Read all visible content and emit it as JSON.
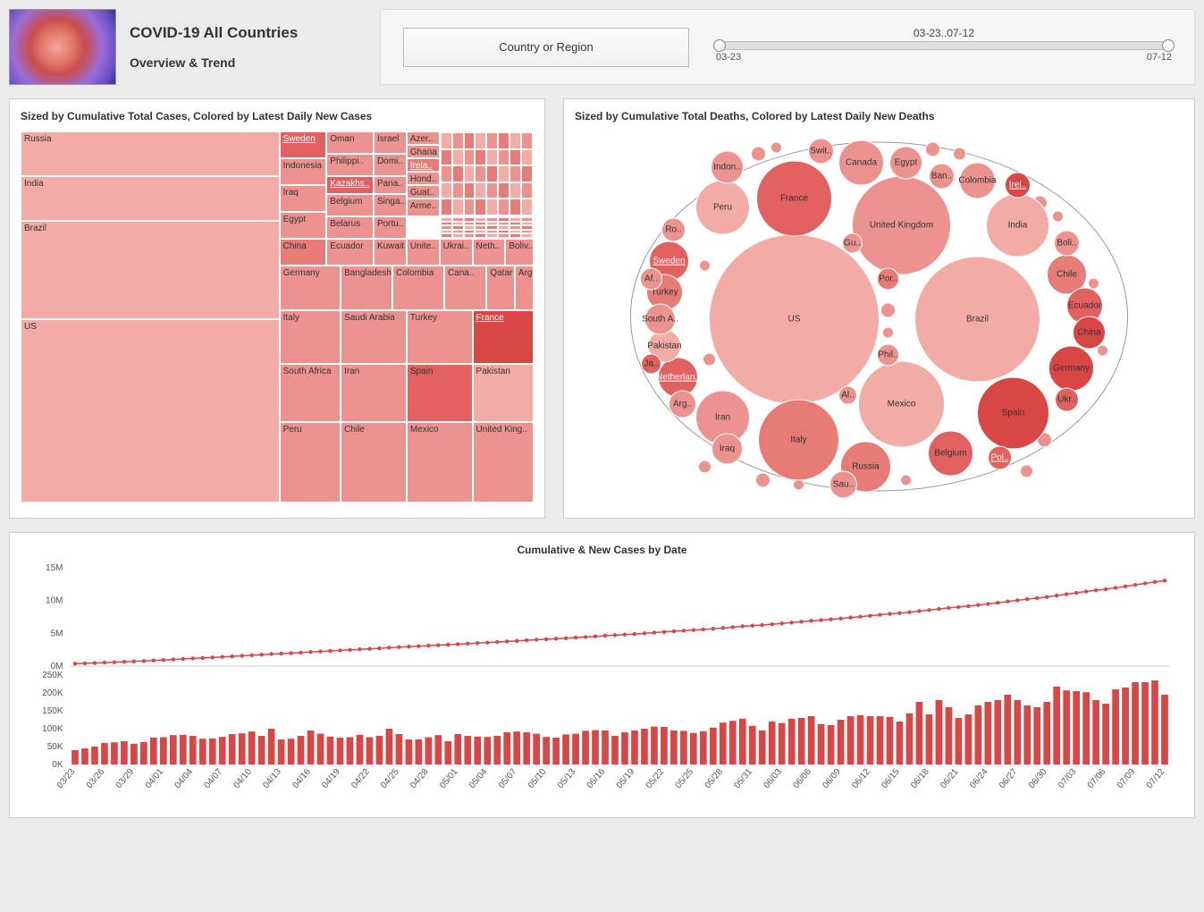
{
  "header": {
    "title": "COVID-19 All Countries",
    "subtitle": "Overview & Trend"
  },
  "filter": {
    "button_label": "Country or Region",
    "slider_label": "03-23..07-12",
    "slider_start": "03-23",
    "slider_end": "07-12"
  },
  "treemap_panel": {
    "title": "Sized by Cumulative Total Cases, Colored by Latest Daily New Cases"
  },
  "bubble_panel": {
    "title": "Sized by Cumulative Total Deaths, Colored by Latest Daily New Deaths"
  },
  "combo_panel": {
    "title": "Cumulative & New Cases by Date"
  },
  "chart_data": [
    {
      "type": "treemap",
      "title": "Sized by Cumulative Total Cases, Colored by Latest Daily New Cases",
      "items": [
        {
          "name": "US",
          "size": 3400000,
          "shade": 1
        },
        {
          "name": "Brazil",
          "size": 1850000,
          "shade": 1
        },
        {
          "name": "India",
          "size": 880000,
          "shade": 1
        },
        {
          "name": "Russia",
          "size": 730000,
          "shade": 1
        },
        {
          "name": "Peru",
          "size": 330000,
          "shade": 2
        },
        {
          "name": "Chile",
          "size": 315000,
          "shade": 2
        },
        {
          "name": "Mexico",
          "size": 300000,
          "shade": 2
        },
        {
          "name": "United Kingdom",
          "size": 290000,
          "shade": 2
        },
        {
          "name": "South Africa",
          "size": 275000,
          "shade": 2
        },
        {
          "name": "Iran",
          "size": 260000,
          "shade": 2
        },
        {
          "name": "Spain",
          "size": 255000,
          "shade": 4
        },
        {
          "name": "Pakistan",
          "size": 250000,
          "shade": 1
        },
        {
          "name": "Italy",
          "size": 243000,
          "shade": 2
        },
        {
          "name": "Saudi Arabia",
          "size": 235000,
          "shade": 2
        },
        {
          "name": "Turkey",
          "size": 215000,
          "shade": 2
        },
        {
          "name": "France",
          "size": 210000,
          "shade": 5,
          "highlight": true
        },
        {
          "name": "Germany",
          "size": 200000,
          "shade": 2
        },
        {
          "name": "Bangladesh",
          "size": 185000,
          "shade": 2
        },
        {
          "name": "Colombia",
          "size": 150000,
          "shade": 2
        },
        {
          "name": "Canada",
          "size": 108000,
          "shade": 2
        },
        {
          "name": "Qatar",
          "size": 104000,
          "shade": 2
        },
        {
          "name": "Argentina",
          "size": 100000,
          "shade": 2
        },
        {
          "name": "China",
          "size": 85000,
          "shade": 3
        },
        {
          "name": "Egypt",
          "size": 82000,
          "shade": 2
        },
        {
          "name": "Iraq",
          "size": 77000,
          "shade": 2
        },
        {
          "name": "Indonesia",
          "size": 75000,
          "shade": 2
        },
        {
          "name": "Sweden",
          "size": 75000,
          "shade": 4,
          "highlight": true
        },
        {
          "name": "Belarus",
          "size": 65000,
          "shade": 2
        },
        {
          "name": "Ecuador",
          "size": 68000,
          "shade": 2
        },
        {
          "name": "Belgium",
          "size": 62000,
          "shade": 2
        },
        {
          "name": "Kazakhstan",
          "size": 59000,
          "shade": 4,
          "highlight": true
        },
        {
          "name": "Oman",
          "size": 56000,
          "shade": 2
        },
        {
          "name": "Philippines",
          "size": 56000,
          "shade": 2
        },
        {
          "name": "Kuwait",
          "size": 55000,
          "shade": 2
        },
        {
          "name": "United Arab Emirates",
          "size": 55000,
          "shade": 2
        },
        {
          "name": "Ukraine",
          "size": 54000,
          "shade": 2
        },
        {
          "name": "Netherlands",
          "size": 51000,
          "shade": 2
        },
        {
          "name": "Bolivia",
          "size": 48000,
          "shade": 2
        },
        {
          "name": "Panama",
          "size": 45000,
          "shade": 2
        },
        {
          "name": "Singapore",
          "size": 46000,
          "shade": 2
        },
        {
          "name": "Portugal",
          "size": 46000,
          "shade": 2
        },
        {
          "name": "Dominican Republic",
          "size": 44000,
          "shade": 2
        },
        {
          "name": "Israel",
          "size": 40000,
          "shade": 2
        },
        {
          "name": "Honduras",
          "size": 28000,
          "shade": 2
        },
        {
          "name": "Guatemala",
          "size": 28000,
          "shade": 2
        },
        {
          "name": "Armenia",
          "size": 32000,
          "shade": 2
        },
        {
          "name": "Ghana",
          "size": 25000,
          "shade": 2
        },
        {
          "name": "Azerbaijan",
          "size": 24000,
          "shade": 2
        },
        {
          "name": "Ireland",
          "size": 26000,
          "shade": 3,
          "highlight": true
        }
      ]
    },
    {
      "type": "bubble",
      "title": "Sized by Cumulative Total Deaths, Colored by Latest Daily New Deaths",
      "items": [
        {
          "name": "US",
          "size": 137000,
          "shade": 1
        },
        {
          "name": "Brazil",
          "size": 72000,
          "shade": 1
        },
        {
          "name": "United Kingdom",
          "size": 45000,
          "shade": 2
        },
        {
          "name": "Mexico",
          "size": 35000,
          "shade": 1
        },
        {
          "name": "Italy",
          "size": 35000,
          "shade": 3
        },
        {
          "name": "France",
          "size": 30000,
          "shade": 4
        },
        {
          "name": "Spain",
          "size": 28000,
          "shade": 5
        },
        {
          "name": "India",
          "size": 23000,
          "shade": 1
        },
        {
          "name": "Iran",
          "size": 13000,
          "shade": 2
        },
        {
          "name": "Peru",
          "size": 12000,
          "shade": 1
        },
        {
          "name": "Russia",
          "size": 11000,
          "shade": 3
        },
        {
          "name": "Belgium",
          "size": 9800,
          "shade": 4
        },
        {
          "name": "Germany",
          "size": 9100,
          "shade": 5
        },
        {
          "name": "Canada",
          "size": 8800,
          "shade": 2
        },
        {
          "name": "Chile",
          "size": 7000,
          "shade": 3
        },
        {
          "name": "Netherlands",
          "size": 6100,
          "shade": 4,
          "highlight": true
        },
        {
          "name": "Sweden",
          "size": 5500,
          "shade": 4,
          "highlight": true
        },
        {
          "name": "Turkey",
          "size": 5400,
          "shade": 3
        },
        {
          "name": "Ecuador",
          "size": 5100,
          "shade": 4
        },
        {
          "name": "Colombia",
          "size": 5100,
          "shade": 2
        },
        {
          "name": "China",
          "size": 4600,
          "shade": 5
        },
        {
          "name": "Pakistan",
          "size": 5300,
          "shade": 1
        },
        {
          "name": "Indonesia",
          "size": 3700,
          "shade": 2
        },
        {
          "name": "Egypt",
          "size": 3900,
          "shade": 2
        },
        {
          "name": "Iraq",
          "size": 3200,
          "shade": 2
        },
        {
          "name": "South Africa",
          "size": 4100,
          "shade": 2
        },
        {
          "name": "Argentina",
          "size": 1800,
          "shade": 2
        },
        {
          "name": "Saudi Arabia",
          "size": 2100,
          "shade": 2
        },
        {
          "name": "Bolivia",
          "size": 1800,
          "shade": 2
        },
        {
          "name": "Switzerland",
          "size": 1900,
          "shade": 2
        },
        {
          "name": "Bangladesh",
          "size": 2400,
          "shade": 2
        },
        {
          "name": "Ireland",
          "size": 1700,
          "shade": 5,
          "highlight": true
        },
        {
          "name": "Romania",
          "size": 1900,
          "shade": 2
        },
        {
          "name": "Afghanistan",
          "size": 1000,
          "shade": 2
        },
        {
          "name": "Philippines",
          "size": 1400,
          "shade": 2
        },
        {
          "name": "Portugal",
          "size": 1700,
          "shade": 3
        },
        {
          "name": "Poland",
          "size": 1600,
          "shade": 4,
          "highlight": true
        },
        {
          "name": "Ukraine",
          "size": 1400,
          "shade": 4
        },
        {
          "name": "Guatemala",
          "size": 1200,
          "shade": 2
        },
        {
          "name": "Algeria",
          "size": 1000,
          "shade": 2
        },
        {
          "name": "Japan",
          "size": 1000,
          "shade": 4
        }
      ]
    },
    {
      "type": "combo",
      "title": "Cumulative & New Cases by Date",
      "x": [
        "03/23",
        "03/24",
        "03/25",
        "03/26",
        "03/27",
        "03/28",
        "03/29",
        "03/30",
        "03/31",
        "04/01",
        "04/02",
        "04/03",
        "04/04",
        "04/05",
        "04/06",
        "04/07",
        "04/08",
        "04/09",
        "04/10",
        "04/11",
        "04/12",
        "04/13",
        "04/14",
        "04/15",
        "04/16",
        "04/17",
        "04/18",
        "04/19",
        "04/20",
        "04/21",
        "04/22",
        "04/23",
        "04/24",
        "04/25",
        "04/26",
        "04/27",
        "04/28",
        "04/29",
        "04/30",
        "05/01",
        "05/02",
        "05/03",
        "05/04",
        "05/05",
        "05/06",
        "05/07",
        "05/08",
        "05/09",
        "05/10",
        "05/11",
        "05/12",
        "05/13",
        "05/14",
        "05/15",
        "05/16",
        "05/17",
        "05/18",
        "05/19",
        "05/20",
        "05/21",
        "05/22",
        "05/23",
        "05/24",
        "05/25",
        "05/26",
        "05/27",
        "05/28",
        "05/29",
        "05/30",
        "05/31",
        "06/01",
        "06/02",
        "06/03",
        "06/04",
        "06/05",
        "06/06",
        "06/07",
        "06/08",
        "06/09",
        "06/10",
        "06/11",
        "06/12",
        "06/13",
        "06/14",
        "06/15",
        "06/16",
        "06/17",
        "06/18",
        "06/19",
        "06/20",
        "06/21",
        "06/22",
        "06/23",
        "06/24",
        "06/25",
        "06/26",
        "06/27",
        "06/28",
        "06/29",
        "06/30",
        "07/01",
        "07/02",
        "07/03",
        "07/04",
        "07/05",
        "07/06",
        "07/07",
        "07/08",
        "07/09",
        "07/10",
        "07/11",
        "07/12"
      ],
      "xlabel": "",
      "series": [
        {
          "name": "Cumulative",
          "type": "line",
          "ylim": [
            0,
            15000000
          ],
          "yticks": [
            "0M",
            "5M",
            "10M",
            "15M"
          ],
          "values": [
            380000,
            420000,
            470000,
            530000,
            590000,
            660000,
            720000,
            780000,
            860000,
            930000,
            1010000,
            1100000,
            1180000,
            1250000,
            1320000,
            1400000,
            1480000,
            1570000,
            1660000,
            1740000,
            1840000,
            1910000,
            1980000,
            2060000,
            2160000,
            2240000,
            2320000,
            2400000,
            2470000,
            2560000,
            2630000,
            2720000,
            2820000,
            2900000,
            2970000,
            3040000,
            3120000,
            3200000,
            3260000,
            3350000,
            3430000,
            3510000,
            3590000,
            3670000,
            3760000,
            3850000,
            3940000,
            4030000,
            4100000,
            4180000,
            4260000,
            4350000,
            4440000,
            4540000,
            4640000,
            4720000,
            4810000,
            4900000,
            5000000,
            5110000,
            5210000,
            5310000,
            5410000,
            5500000,
            5590000,
            5700000,
            5820000,
            5940000,
            6070000,
            6170000,
            6270000,
            6390000,
            6510000,
            6640000,
            6770000,
            6910000,
            7020000,
            7130000,
            7260000,
            7400000,
            7540000,
            7680000,
            7820000,
            7960000,
            8080000,
            8220000,
            8400000,
            8540000,
            8720000,
            8880000,
            9010000,
            9150000,
            9310000,
            9490000,
            9670000,
            9860000,
            10040000,
            10210000,
            10370000,
            10540000,
            10760000,
            10970000,
            11180000,
            11380000,
            11560000,
            11730000,
            11940000,
            12160000,
            12390000,
            12620000,
            12850000,
            13040000
          ]
        },
        {
          "name": "New",
          "type": "bar",
          "ylim": [
            0,
            250000
          ],
          "yticks": [
            "0K",
            "50K",
            "100K",
            "150K",
            "200K",
            "250K"
          ],
          "values": [
            40000,
            45000,
            50000,
            60000,
            62000,
            65000,
            58000,
            63000,
            75000,
            76000,
            82000,
            83000,
            80000,
            72000,
            73000,
            77000,
            85000,
            87000,
            92000,
            80000,
            100000,
            70000,
            72000,
            80000,
            95000,
            86000,
            78000,
            75000,
            76000,
            83000,
            76000,
            80000,
            100000,
            85000,
            70000,
            70000,
            76000,
            82000,
            65000,
            85000,
            80000,
            78000,
            77000,
            80000,
            90000,
            92000,
            90000,
            86000,
            77000,
            75000,
            84000,
            86000,
            94000,
            96000,
            95000,
            80000,
            90000,
            95000,
            100000,
            106000,
            105000,
            95000,
            94000,
            88000,
            93000,
            103000,
            117000,
            122000,
            128000,
            108000,
            95000,
            120000,
            116000,
            128000,
            130000,
            135000,
            113000,
            110000,
            125000,
            135000,
            138000,
            135000,
            135000,
            133000,
            120000,
            143000,
            175000,
            140000,
            180000,
            160000,
            130000,
            140000,
            165000,
            175000,
            180000,
            195000,
            180000,
            165000,
            160000,
            175000,
            218000,
            207000,
            205000,
            202000,
            180000,
            170000,
            210000,
            215000,
            230000,
            230000,
            235000,
            195000
          ]
        }
      ]
    }
  ]
}
